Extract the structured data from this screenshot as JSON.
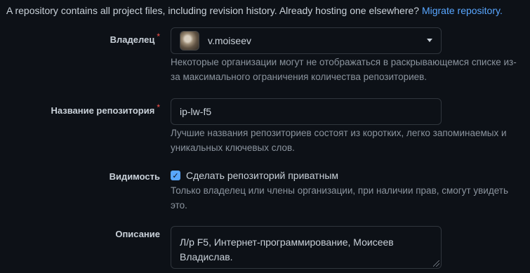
{
  "intro": {
    "text": "A repository contains all project files, including revision history. Already hosting one elsewhere?",
    "link": "Migrate repository."
  },
  "owner": {
    "label": "Владелец",
    "required_mark": "*",
    "value": "v.moiseev",
    "hint": "Некоторые организации могут не отображаться в раскрывающемся списке из-за максимального ограничения количества репозиториев."
  },
  "repo_name": {
    "label": "Название репозитория",
    "required_mark": "*",
    "value": "ip-lw-f5",
    "hint": "Лучшие названия репозиториев состоят из коротких, легко запоминаемых и уникальных ключевых слов."
  },
  "visibility": {
    "label": "Видимость",
    "checkbox_label": "Сделать репозиторий приватным",
    "checked": true,
    "hint": "Только владелец или члены организации, при наличии прав, смогут увидеть это."
  },
  "description": {
    "label": "Описание",
    "value": "Л/р F5, Интернет-программирование, Моисеев Владислав."
  },
  "colors": {
    "background": "#0d1117",
    "link": "#58a6ff",
    "required": "#f85149",
    "muted": "#8b949e"
  }
}
